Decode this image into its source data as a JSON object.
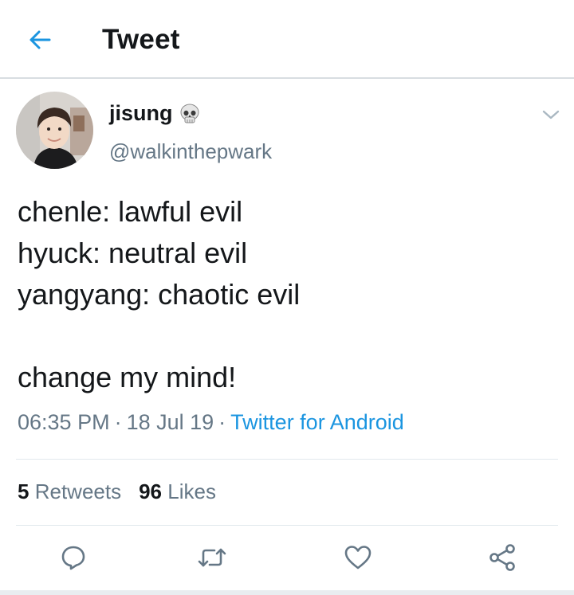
{
  "header": {
    "title": "Tweet"
  },
  "tweet": {
    "author_name": "jisung",
    "author_handle": "@walkinthepwark",
    "name_emoji_icon": "skull-icon",
    "text_lines": [
      "chenle: lawful evil",
      "hyuck: neutral evil",
      "yangyang: chaotic evil",
      "",
      "change my mind!"
    ],
    "time": "06:35 PM",
    "date": "18 Jul 19",
    "separator": "·",
    "source": "Twitter for Android"
  },
  "stats": {
    "retweets_count": "5",
    "retweets_label": "Retweets",
    "likes_count": "96",
    "likes_label": "Likes"
  },
  "actions": [
    "reply-icon",
    "retweet-icon",
    "like-icon",
    "share-icon"
  ],
  "colors": {
    "accent": "#1b95e0",
    "text": "#14171a",
    "secondary": "#657786",
    "icon": "#657786",
    "divider": "#e1e8ed"
  }
}
